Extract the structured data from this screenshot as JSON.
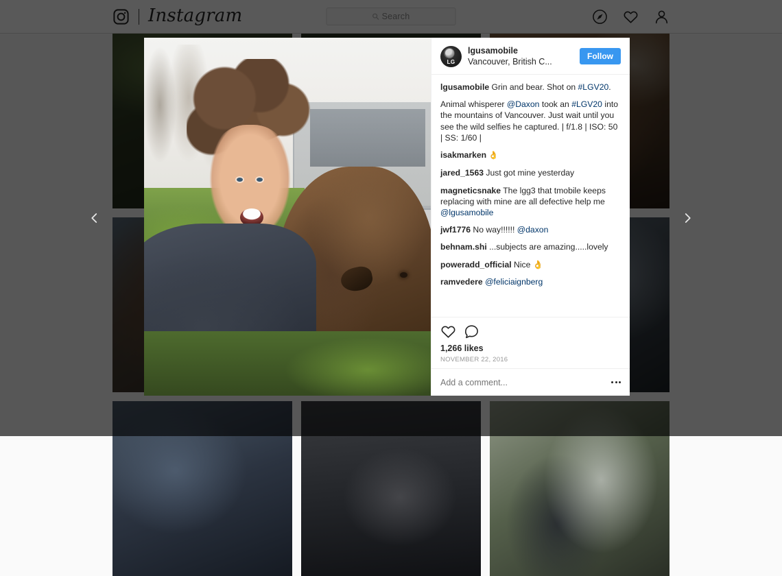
{
  "navbar": {
    "logo_icon": "instagram-camera-icon",
    "wordmark": "Instagram",
    "search": {
      "placeholder": "Search",
      "icon": "search-icon"
    },
    "icons": [
      {
        "name": "explore-compass-icon"
      },
      {
        "name": "activity-heart-icon"
      },
      {
        "name": "profile-person-icon"
      }
    ]
  },
  "carousel": {
    "prev_label": "‹",
    "next_label": "›"
  },
  "modal": {
    "post": {
      "avatar_text": "LG",
      "username": "lgusamobile",
      "location": "Vancouver, British C...",
      "follow_label": "Follow",
      "caption": {
        "username": "lgusamobile",
        "text_1": " Grin and bear. Shot on ",
        "hashtag": "#LGV20",
        "text_2": "."
      },
      "description": {
        "pre": "Animal whisperer ",
        "mention": "@Daxon",
        "mid": " took an ",
        "hashtag": "#LGV20",
        "post": " into the mountains of Vancouver. Just wait until you see the wild selfies he captured. | f/1.8 | ISO: 50 | SS: 1/60 |"
      },
      "comments": [
        {
          "username": "isakmarken",
          "text": " 👌"
        },
        {
          "username": "jared_1563",
          "text": " Just got mine yesterday"
        },
        {
          "username": "magneticsnake",
          "text": " The lgg3 that tmobile keeps replacing with mine are all defective help me ",
          "mention": "@lgusamobile"
        },
        {
          "username": "jwf1776",
          "text": " No way!!!!!! ",
          "mention": "@daxon"
        },
        {
          "username": "behnam.shi",
          "text": " ...subjects are amazing.....lovely"
        },
        {
          "username": "poweradd_official",
          "text": " Nice 👌"
        },
        {
          "username": "ramvedere",
          "text": " ",
          "mention": "@feliciaignberg"
        }
      ],
      "actions": {
        "like_icon": "heart-icon",
        "comment_icon": "speech-bubble-icon",
        "likes": "1,266 likes",
        "date": "NOVEMBER 22, 2016"
      },
      "add_comment": {
        "placeholder": "Add a comment...",
        "more_icon": "ellipsis-icon"
      }
    },
    "photo_alt": "man taking selfie with brown bear"
  },
  "background_grid": {
    "tiles": [
      {
        "name": "tile-forest-path",
        "style": "ph-forest"
      },
      {
        "name": "tile-dark-woods",
        "style": "ph-dark-woods"
      },
      {
        "name": "tile-bear-portrait",
        "style": "ph-bear-big"
      },
      {
        "name": "tile-bear-closeup",
        "style": "ph-bear-close"
      },
      {
        "name": "tile-night-hand",
        "style": "ph-night-hand"
      },
      {
        "name": "tile-fence-enclosure",
        "style": "ph-fence"
      },
      {
        "name": "tile-cyclist",
        "style": "ph-cyclist"
      },
      {
        "name": "tile-bike-dark",
        "style": "ph-bike-dark"
      },
      {
        "name": "tile-selfie-guy",
        "style": "ph-selfie-guy"
      }
    ]
  },
  "colors": {
    "accent_blue": "#3897f0",
    "link_blue": "#003569",
    "text_dark": "#262626",
    "muted": "#8e8e8e",
    "overlay": "rgba(0,0,0,0.65)"
  }
}
